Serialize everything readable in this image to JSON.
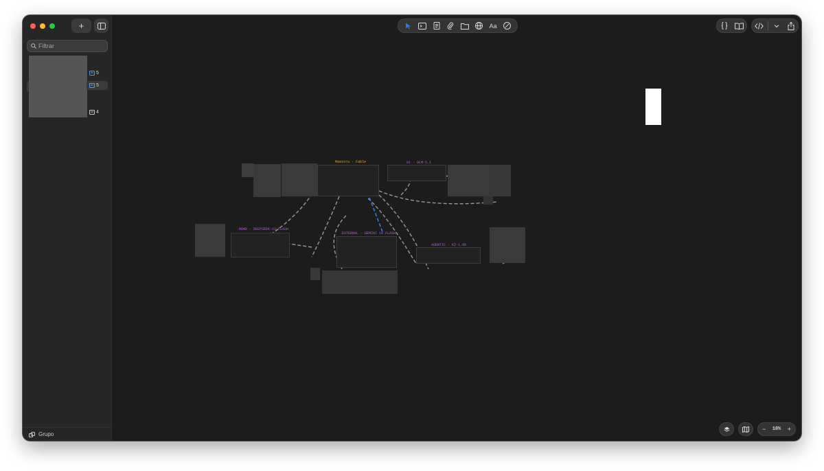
{
  "sidebar": {
    "search_placeholder": "Filtrar",
    "items": [
      {
        "count": "5"
      },
      {
        "count": "5"
      },
      {
        "count": "4"
      }
    ],
    "footer_label": "Grupo"
  },
  "toolbar": {
    "tools": [
      "pointer-icon",
      "terminal-icon",
      "script-icon",
      "attachment-icon",
      "folder-icon",
      "globe-icon",
      "text-icon",
      "compass-icon"
    ],
    "text_tool_label": "Aa"
  },
  "canvas": {
    "nodes": [
      {
        "title": "Maestro - Fable",
        "color": "#e8a33a"
      },
      {
        "title": "01 - GLM-5.1",
        "color": "#b15ce0"
      },
      {
        "title": "ROND - DEEPSEEK-V3-FLASH",
        "color": "#b15ce0"
      },
      {
        "title": "EXTERNAL - GEMINI vs FLASH",
        "color": "#b15ce0"
      },
      {
        "title": "AGENTIC - K2-1.6K",
        "color": "#b15ce0"
      }
    ]
  },
  "zoom": {
    "level": "10%",
    "minus": "−",
    "plus": "+"
  },
  "colors": {
    "window_bg": "#1c1c1c",
    "sidebar_bg": "#262626",
    "accent": "#2f7de1"
  }
}
